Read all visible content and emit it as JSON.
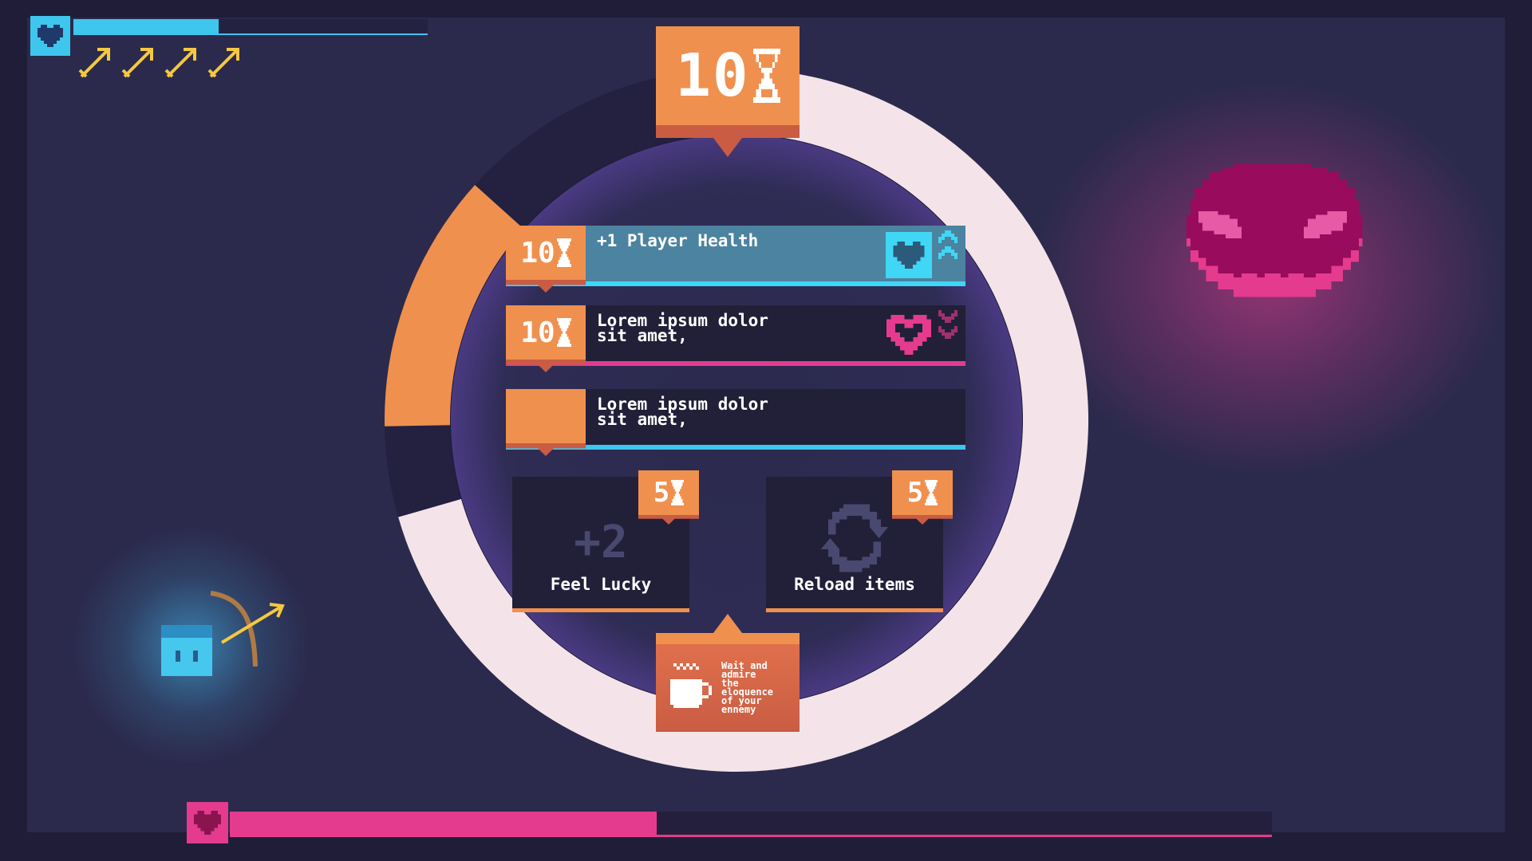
{
  "hud": {
    "player_heart_icon": "heart-icon",
    "player_health_fraction": 0.41,
    "arrows_count": 4,
    "boss_heart_icon": "heart-icon",
    "boss_health_fraction": 0.41
  },
  "timer": {
    "cost": "10",
    "icon": "hourglass-icon"
  },
  "ring": {
    "fill_fraction": 0.7,
    "track_color": "#f4e4ea",
    "used_color": "#232040",
    "accent_color": "#f0904e"
  },
  "options": [
    {
      "cost": "10",
      "label": "+1 Player Health",
      "icon": "heart-icon",
      "rank_icon": "chevron-up-icon"
    },
    {
      "cost": "10",
      "label": "Lorem ipsum dolor\nsit amet,",
      "icon": "heart-icon",
      "rank_icon": "chevron-down-icon"
    },
    {
      "cost": "",
      "label": "Lorem ipsum dolor\nsit amet,"
    }
  ],
  "cards": [
    {
      "cost": "5",
      "icon_text": "+2",
      "label": "Feel Lucky"
    },
    {
      "cost": "5",
      "icon": "reload-icon",
      "label": "Reload items"
    }
  ],
  "wait": {
    "label": "Wait and\nadmire\nthe\neloquence\nof your\nennemy",
    "icon": "coffee-icon"
  },
  "colors": {
    "orange": "#f0904e",
    "cyan": "#3fc6ee",
    "pink": "#e43b8f",
    "bg": "#2b2a4c"
  }
}
